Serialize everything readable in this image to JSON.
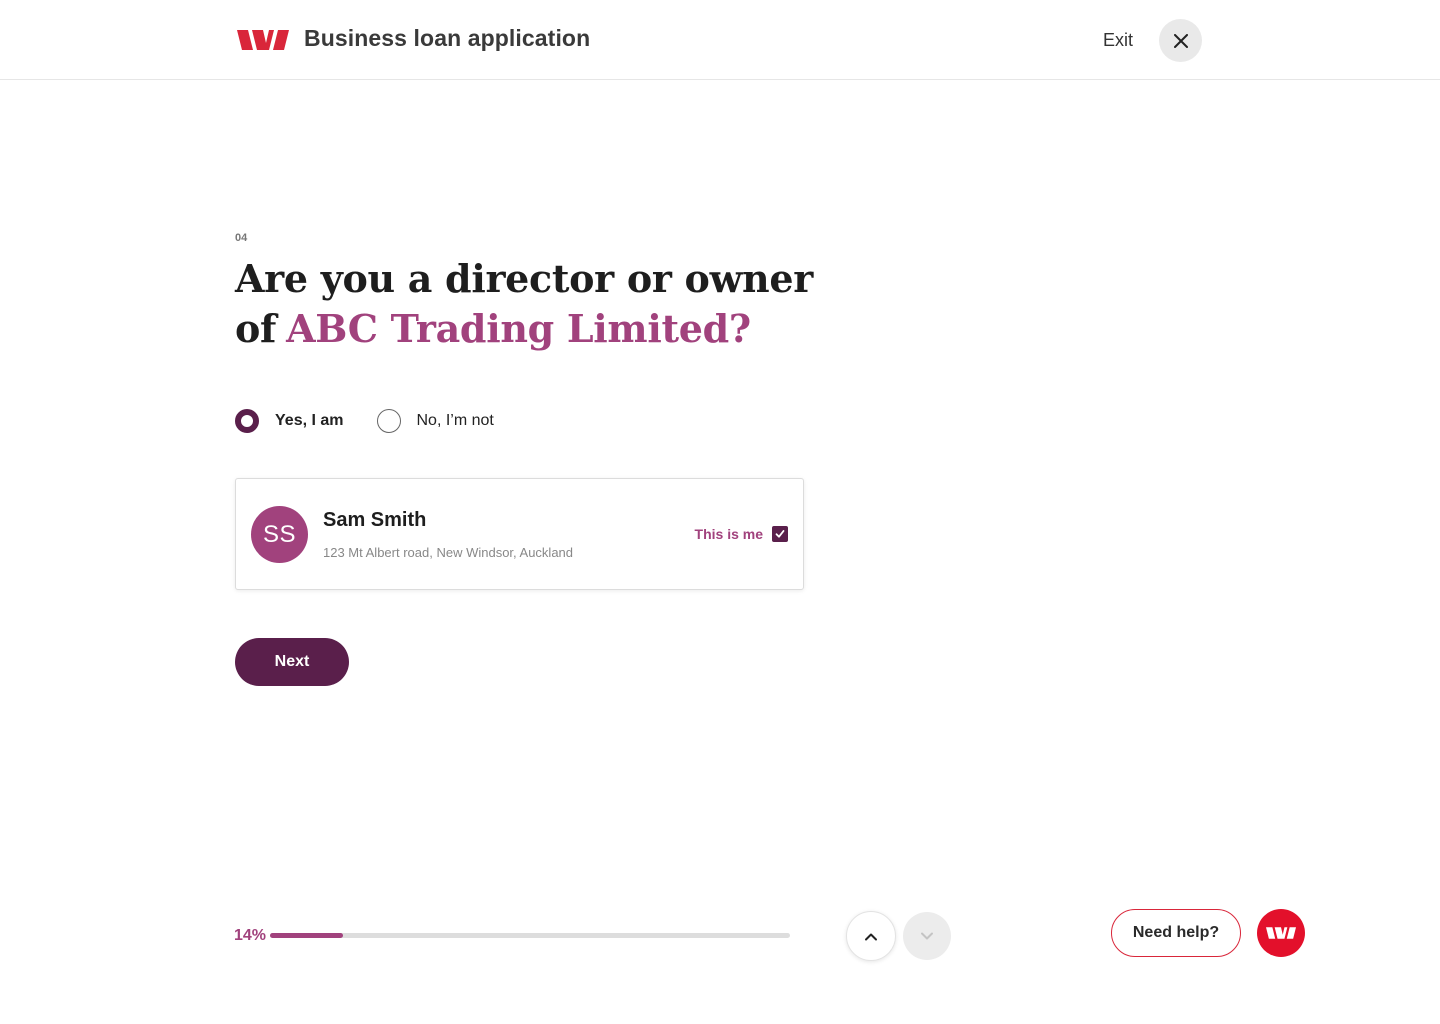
{
  "header": {
    "logo": "westpac-logo",
    "title": "Business loan application",
    "exit_label": "Exit",
    "close_icon": "close-icon"
  },
  "question": {
    "step": "04",
    "text_prefix": "Are you a director or owner of",
    "company_name": "ABC Trading Limited?"
  },
  "options": [
    {
      "label": "Yes, I am",
      "selected": true
    },
    {
      "label": "No, I’m not",
      "selected": false
    }
  ],
  "person": {
    "initials": "SS",
    "name": "Sam Smith",
    "address": "123 Mt Albert road, New Windsor, Auckland",
    "this_is_me_label": "This is me",
    "this_is_me_checked": true
  },
  "next_label": "Next",
  "progress": {
    "label": "14%",
    "value": 0.14
  },
  "navigation": {
    "up_icon": "chevron-up-icon",
    "down_icon": "chevron-down-icon"
  },
  "help": {
    "label": "Need help?",
    "logo_icon": "westpac-logo-icon"
  },
  "colors": {
    "brand_red": "#d9263a",
    "accent_plum": "#a1427d",
    "dark_plum": "#5a1f4b"
  }
}
